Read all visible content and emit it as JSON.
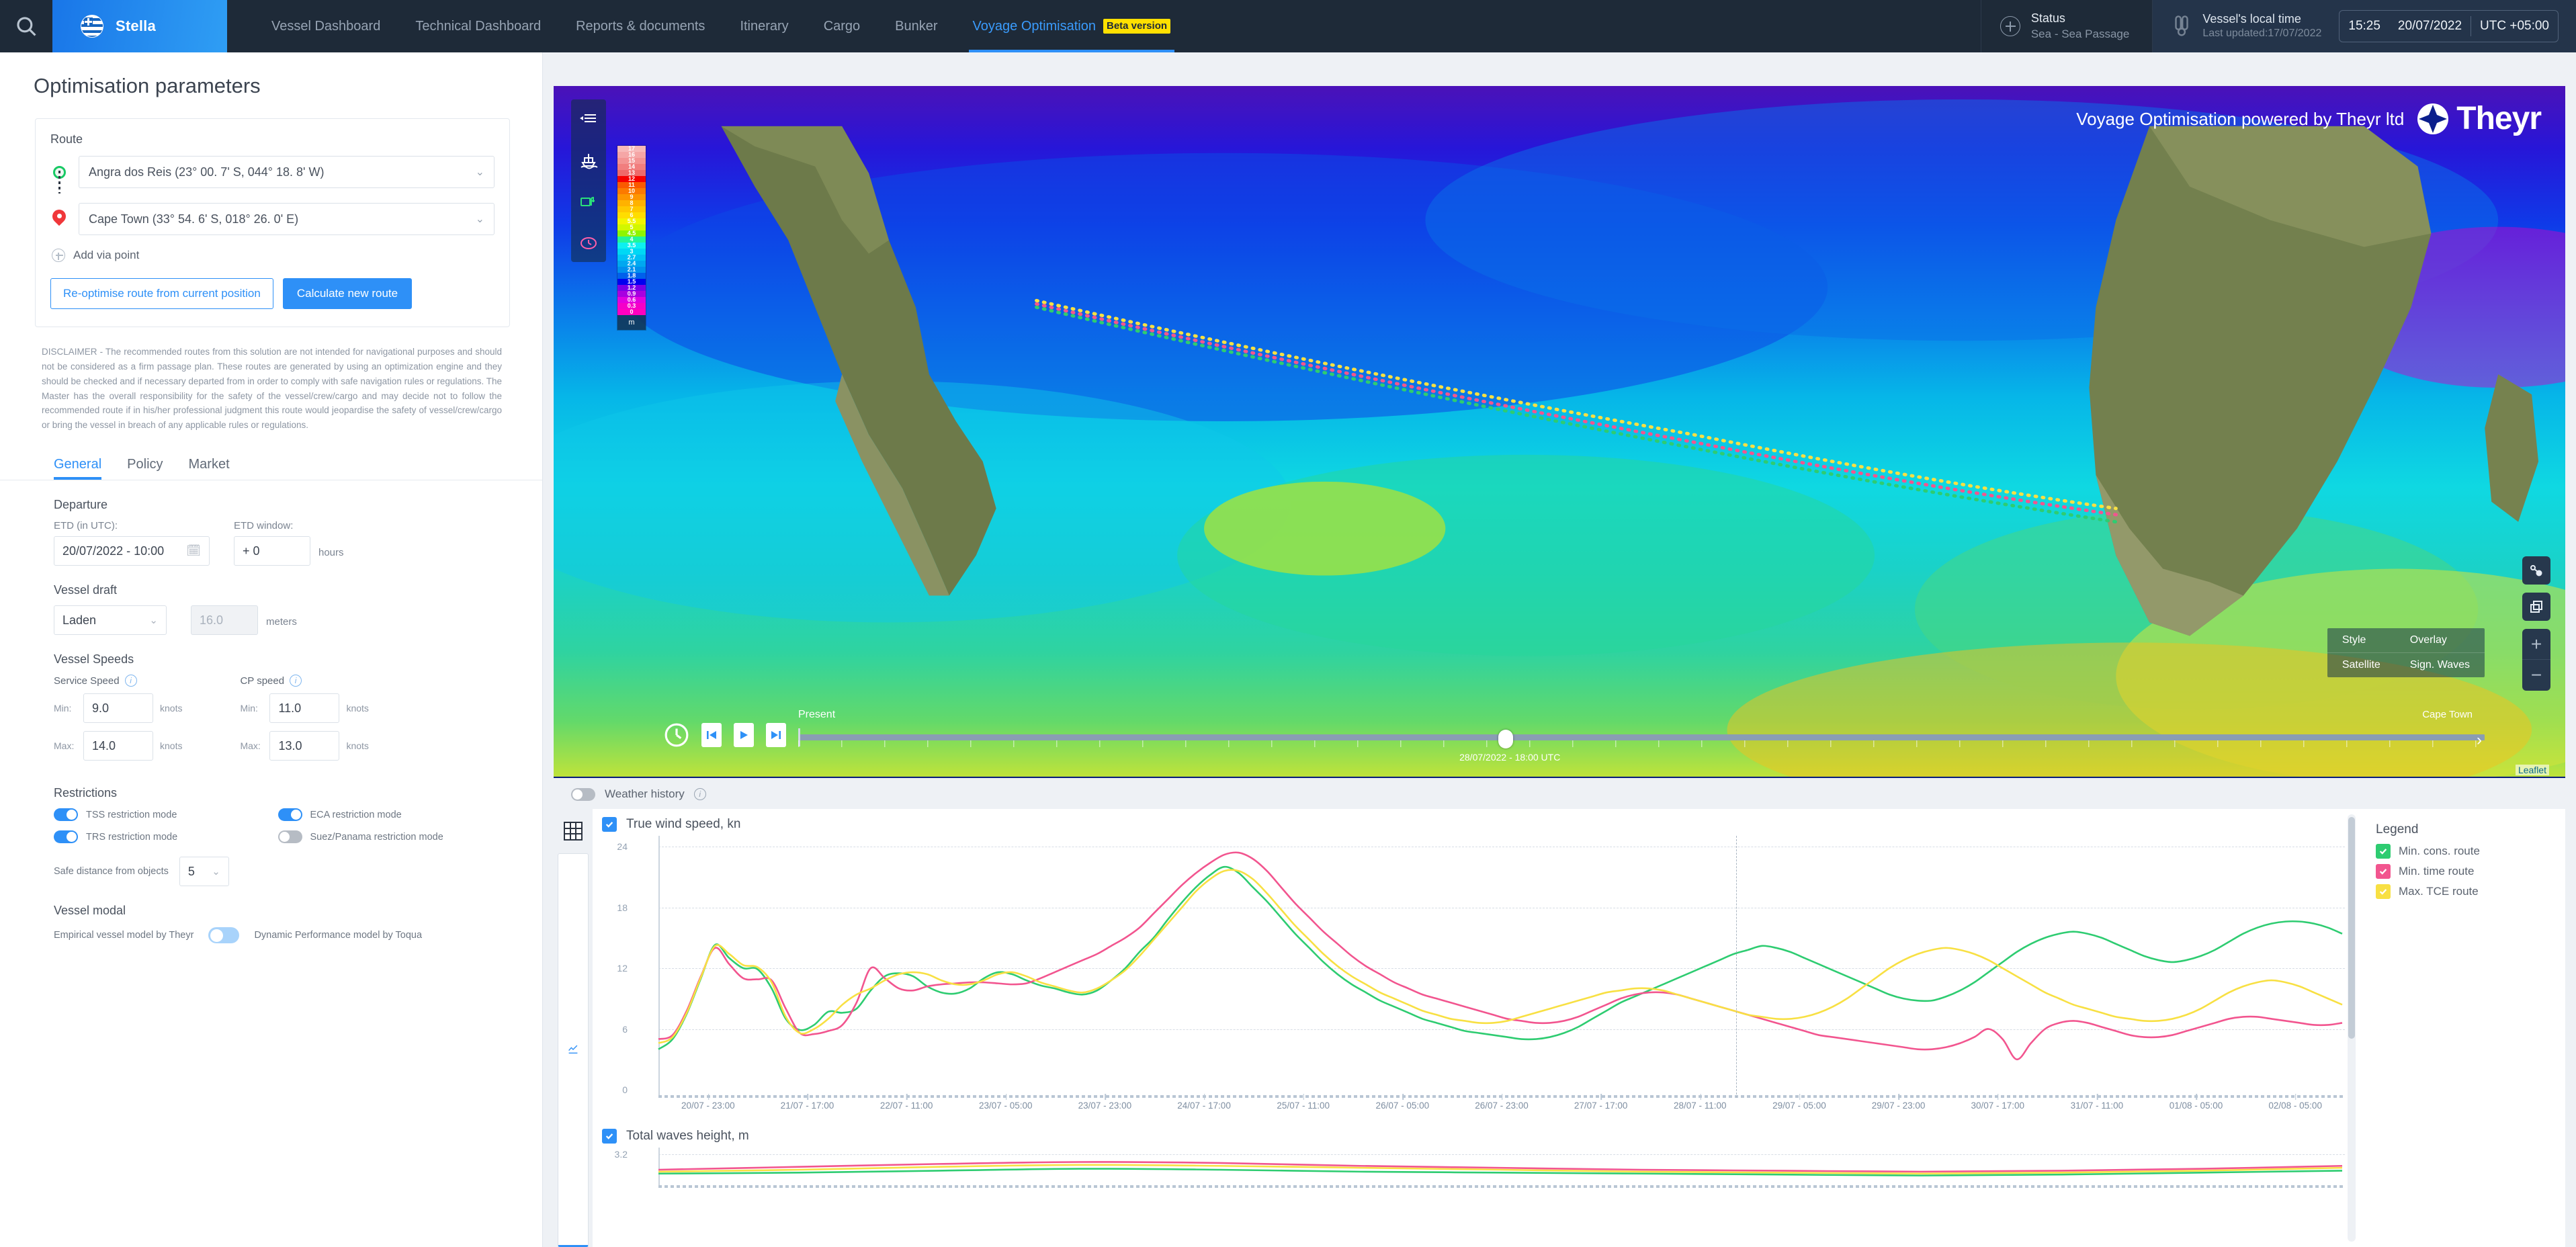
{
  "header": {
    "search_icon": "search-icon",
    "vessel_name": "Stella",
    "nav_items": [
      {
        "label": "Vessel Dashboard",
        "active": false
      },
      {
        "label": "Technical Dashboard",
        "active": false
      },
      {
        "label": "Reports & documents",
        "active": false
      },
      {
        "label": "Itinerary",
        "active": false
      },
      {
        "label": "Cargo",
        "active": false
      },
      {
        "label": "Bunker",
        "active": false
      },
      {
        "label": "Voyage Optimisation",
        "active": true,
        "badge": "Beta version"
      }
    ],
    "status": {
      "title": "Status",
      "value": "Sea - Sea Passage"
    },
    "local_time": {
      "title": "Vessel's local time",
      "updated": "Last updated:17/07/2022",
      "time": "15:25",
      "date": "20/07/2022",
      "tz": "UTC +05:00"
    }
  },
  "panel": {
    "title": "Optimisation parameters",
    "route": {
      "label": "Route",
      "origin": "Angra dos Reis (23° 00. 7' S, 044° 18. 8' W)",
      "destination": "Cape Town (33° 54. 6' S, 018° 26. 0' E)",
      "add_via": "Add via point",
      "reoptimise_btn": "Re-optimise route from current position",
      "calculate_btn": "Calculate new route"
    },
    "disclaimer": "DISCLAIMER - The recommended routes from this solution are not intended for navigational purposes and should not be considered as a firm passage plan. These routes are generated by using an optimization engine and they should be checked and if necessary departed from in order to comply with safe navigation rules or regulations. The Master has the overall responsibility for the safety of the vessel/crew/cargo and may decide not to follow the recommended route if in his/her professional judgment this route would jeopardise the safety of vessel/crew/cargo or bring the vessel in breach of any applicable rules or regulations.",
    "tabs": [
      {
        "label": "General",
        "active": true
      },
      {
        "label": "Policy",
        "active": false
      },
      {
        "label": "Market",
        "active": false
      }
    ],
    "departure": {
      "heading": "Departure",
      "etd_label": "ETD (in UTC):",
      "etd_value": "20/07/2022 - 10:00",
      "window_label": "ETD window:",
      "window_value": "+ 0",
      "window_unit": "hours"
    },
    "draft": {
      "heading": "Vessel draft",
      "condition": "Laden",
      "value": "16.0",
      "unit": "meters"
    },
    "speeds": {
      "heading": "Vessel Speeds",
      "service": {
        "label": "Service Speed",
        "min_label": "Min:",
        "min": "9.0",
        "max_label": "Max:",
        "max": "14.0",
        "unit": "knots"
      },
      "cp": {
        "label": "CP speed",
        "min_label": "Min:",
        "min": "11.0",
        "max_label": "Max:",
        "max": "13.0",
        "unit": "knots"
      }
    },
    "restrictions": {
      "heading": "Restrictions",
      "items": [
        {
          "label": "TSS restriction mode",
          "on": true
        },
        {
          "label": "ECA restriction mode",
          "on": true
        },
        {
          "label": "TRS restriction mode",
          "on": true
        },
        {
          "label": "Suez/Panama restriction mode",
          "on": false
        }
      ],
      "safe_distance_label": "Safe distance from objects",
      "safe_distance_value": "5"
    },
    "vessel_modal": {
      "heading": "Vessel modal",
      "left": "Empirical vessel model by Theyr",
      "right": "Dynamic Performance model by Toqua"
    }
  },
  "map": {
    "branding": "Voyage Optimisation powered by Theyr ltd",
    "brand_name": "Theyr",
    "tools": [
      "legend-icon",
      "ship-icon",
      "bunker-icon",
      "clock-icon"
    ],
    "scale_unit": "m",
    "scale_values": [
      "17",
      "16",
      "15",
      "14",
      "13",
      "12",
      "11",
      "10",
      "9",
      "8",
      "7",
      "6",
      "5.5",
      "5",
      "4.5",
      "4",
      "3.5",
      "3",
      "2.7",
      "2.4",
      "2.1",
      "1.8",
      "1.5",
      "1.2",
      "0.9",
      "0.6",
      "0.3",
      "0"
    ],
    "scale_colors": [
      "#f7b9b9",
      "#f5a6a6",
      "#f39393",
      "#f17e7e",
      "#ef6a6a",
      "#f50000",
      "#fa5a00",
      "#fc7a00",
      "#fd9600",
      "#ffb200",
      "#ffc800",
      "#ffdd00",
      "#f2f500",
      "#d2f700",
      "#8ef500",
      "#22f59a",
      "#0df0f0",
      "#00d8f5",
      "#00c0f5",
      "#00a8f0",
      "#0090ee",
      "#0060ec",
      "#0000f0",
      "#7a00e8",
      "#a800e0",
      "#e000e0",
      "#f500c8",
      "#ff00c0"
    ],
    "timeline": {
      "present_label": "Present",
      "current_value": "28/07/2022 - 18:00 UTC",
      "destination_label": "Cape Town"
    },
    "style_panel": {
      "style_label": "Style",
      "style_value": "Overlay",
      "satellite_label": "Satellite",
      "satellite_value": "Sign. Waves"
    },
    "controls": [
      "measure-icon",
      "layers-icon",
      "zoom-in",
      "zoom-out"
    ],
    "attribution": "Leaflet"
  },
  "weather_history": {
    "label": "Weather history",
    "on": false
  },
  "charts_legend": {
    "title": "Legend",
    "items": [
      {
        "label": "Min. cons. route",
        "color": "#2ecc71",
        "checked": true
      },
      {
        "label": "Min. time route",
        "color": "#f2558f",
        "checked": true
      },
      {
        "label": "Max. TCE route",
        "color": "#f8e043",
        "checked": true
      }
    ]
  },
  "chart_data": [
    {
      "type": "line",
      "title": "True wind speed, kn",
      "checked": true,
      "xlabel": "",
      "ylabel": "kn",
      "ylim": [
        0,
        24
      ],
      "yticks": [
        0,
        6,
        12,
        18,
        24
      ],
      "grid": true,
      "legend_position": "right",
      "tick_labels": [
        "20/07 - 23:00",
        "21/07 - 17:00",
        "22/07 - 11:00",
        "23/07 - 05:00",
        "23/07 - 23:00",
        "24/07 - 17:00",
        "25/07 - 11:00",
        "26/07 - 05:00",
        "26/07 - 23:00",
        "27/07 - 17:00",
        "28/07 - 11:00",
        "29/07 - 05:00",
        "29/07 - 23:00",
        "30/07 - 17:00",
        "31/07 - 11:00",
        "01/08 - 05:00",
        "02/08 - 05:00"
      ],
      "series": [
        {
          "name": "Min. cons. route",
          "color": "#2ecc71",
          "values": [
            4.0,
            5.0,
            7.5,
            11.0,
            14.3,
            13.0,
            12.0,
            11.9,
            10.0,
            7.0,
            5.9,
            6.4,
            7.7,
            7.6,
            8.0,
            9.8,
            11.2,
            11.5,
            11.2,
            10.2,
            9.6,
            9.5,
            10.0,
            11.0,
            11.6,
            11.4,
            10.8,
            10.3,
            10.0,
            9.6,
            9.4,
            9.8,
            10.8,
            12.0,
            13.6,
            15.0,
            16.8,
            18.5,
            20.0,
            21.2,
            22.0,
            21.4,
            20.0,
            18.6,
            17.0,
            15.4,
            14.0,
            12.6,
            11.4,
            10.4,
            9.6,
            8.8,
            8.2,
            7.6,
            7.0,
            6.6,
            6.2,
            5.8,
            5.6,
            5.4,
            5.2,
            5.0,
            5.0,
            5.2,
            5.6,
            6.2,
            7.0,
            7.8,
            8.6,
            9.2,
            9.8,
            10.4,
            11.0,
            11.6,
            12.2,
            12.8,
            13.4,
            13.8,
            14.2,
            14.0,
            13.6,
            13.0,
            12.4,
            11.8,
            11.2,
            10.6,
            10.0,
            9.4,
            9.0,
            8.8,
            8.8,
            9.2,
            9.8,
            10.6,
            11.6,
            12.6,
            13.6,
            14.4,
            15.0,
            15.4,
            15.6,
            15.4,
            15.0,
            14.4,
            13.8,
            13.2,
            12.8,
            12.6,
            12.8,
            13.2,
            13.8,
            14.6,
            15.4,
            16.0,
            16.4,
            16.6,
            16.6,
            16.4,
            16.0,
            15.4
          ]
        },
        {
          "name": "Min. time route",
          "color": "#f2558f",
          "values": [
            5.0,
            5.4,
            7.8,
            11.2,
            14.0,
            12.4,
            11.0,
            10.9,
            10.8,
            8.0,
            5.6,
            5.5,
            5.8,
            6.4,
            8.6,
            12.0,
            11.0,
            10.0,
            9.8,
            10.2,
            10.4,
            10.5,
            10.6,
            10.6,
            10.5,
            10.4,
            10.5,
            11.0,
            11.6,
            12.2,
            12.8,
            13.4,
            14.2,
            15.0,
            16.0,
            17.4,
            18.8,
            20.2,
            21.4,
            22.4,
            23.2,
            23.4,
            22.8,
            21.6,
            20.0,
            18.4,
            17.0,
            15.6,
            14.4,
            13.2,
            12.2,
            11.4,
            10.6,
            10.0,
            9.4,
            9.0,
            8.6,
            8.2,
            7.8,
            7.4,
            7.0,
            6.8,
            6.6,
            6.6,
            6.8,
            7.2,
            7.8,
            8.4,
            9.0,
            9.4,
            9.6,
            9.6,
            9.4,
            9.0,
            8.6,
            8.2,
            7.8,
            7.4,
            7.0,
            6.6,
            6.2,
            5.8,
            5.4,
            5.2,
            5.0,
            4.8,
            4.6,
            4.4,
            4.2,
            4.0,
            4.0,
            4.2,
            4.6,
            5.2,
            6.0,
            5.0,
            3.0,
            4.6,
            6.0,
            6.6,
            6.8,
            6.6,
            6.2,
            5.8,
            5.4,
            5.2,
            5.2,
            5.4,
            5.8,
            6.2,
            6.6,
            7.0,
            7.2,
            7.2,
            7.0,
            6.8,
            6.6,
            6.4,
            6.4,
            6.6
          ]
        },
        {
          "name": "Max. TCE route",
          "color": "#f8e043",
          "values": [
            4.6,
            5.2,
            7.6,
            11.1,
            14.2,
            13.4,
            12.3,
            12.1,
            10.6,
            7.2,
            5.6,
            6.0,
            7.0,
            8.4,
            9.4,
            10.0,
            10.8,
            11.4,
            11.6,
            11.4,
            10.8,
            10.4,
            10.4,
            10.8,
            11.4,
            11.6,
            11.2,
            10.6,
            10.2,
            9.8,
            9.6,
            10.0,
            10.8,
            11.8,
            13.2,
            14.8,
            16.4,
            18.0,
            19.6,
            20.8,
            21.6,
            21.6,
            20.8,
            19.4,
            17.8,
            16.2,
            14.8,
            13.4,
            12.2,
            11.2,
            10.4,
            9.6,
            9.0,
            8.4,
            7.8,
            7.4,
            7.0,
            6.8,
            6.6,
            6.6,
            6.8,
            7.2,
            7.6,
            8.0,
            8.4,
            8.8,
            9.2,
            9.6,
            9.8,
            10.0,
            10.0,
            9.8,
            9.4,
            9.0,
            8.6,
            8.2,
            7.8,
            7.4,
            7.2,
            7.0,
            7.0,
            7.2,
            7.6,
            8.2,
            9.0,
            10.0,
            11.0,
            12.0,
            12.8,
            13.4,
            13.8,
            14.0,
            13.8,
            13.4,
            12.8,
            12.0,
            11.2,
            10.4,
            9.6,
            9.0,
            8.4,
            8.0,
            7.6,
            7.2,
            7.0,
            6.8,
            6.8,
            7.0,
            7.4,
            8.0,
            8.8,
            9.6,
            10.2,
            10.6,
            10.8,
            10.6,
            10.2,
            9.6,
            9.0,
            8.4
          ]
        }
      ]
    },
    {
      "type": "line",
      "title": "Total waves height, m",
      "checked": true,
      "xlabel": "",
      "ylabel": "m",
      "ylim": [
        0,
        3.2
      ],
      "yticks": [
        3.2
      ],
      "grid": true,
      "legend_position": "right",
      "series": [
        {
          "name": "Min. cons. route",
          "color": "#2ecc71",
          "values": [
            1.2,
            1.3,
            1.5,
            1.7,
            1.6,
            1.4,
            1.3,
            1.2,
            1.1,
            1.0,
            1.1,
            1.3,
            1.5
          ]
        },
        {
          "name": "Min. time route",
          "color": "#f2558f",
          "values": [
            1.6,
            1.9,
            2.2,
            2.4,
            2.3,
            2.0,
            1.8,
            1.6,
            1.5,
            1.4,
            1.5,
            1.7,
            2.0
          ]
        },
        {
          "name": "Max. TCE route",
          "color": "#f8e043",
          "values": [
            1.4,
            1.6,
            1.9,
            2.1,
            2.0,
            1.8,
            1.6,
            1.4,
            1.3,
            1.2,
            1.3,
            1.5,
            1.8
          ]
        }
      ]
    }
  ]
}
